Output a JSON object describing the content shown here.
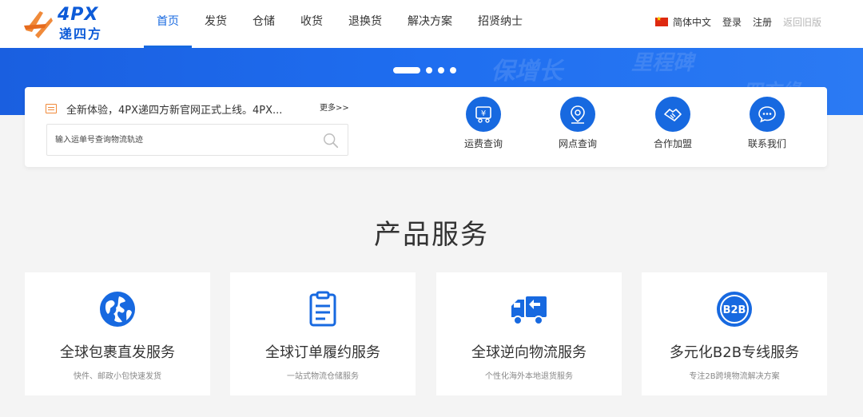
{
  "brand": {
    "logo_text": "4PX",
    "logo_sub": "递四方",
    "primary_color": "#1769e0",
    "accent_color": "#f08a3a"
  },
  "nav": {
    "items": [
      {
        "label": "首页",
        "active": true
      },
      {
        "label": "发货"
      },
      {
        "label": "仓储"
      },
      {
        "label": "收货"
      },
      {
        "label": "退换货"
      },
      {
        "label": "解决方案"
      },
      {
        "label": "招贤纳士"
      }
    ]
  },
  "top_right": {
    "language": "简体中文",
    "login": "登录",
    "register": "注册",
    "old_site": "返回旧版"
  },
  "banner": {
    "slide_count": 4,
    "active_slide": 1,
    "bg_texts": [
      "保增长",
      "里程碑",
      "四方缘"
    ]
  },
  "notice": {
    "text": "全新体验，4PX递四方新官网正式上线。4PX...",
    "more": "更多>>"
  },
  "search": {
    "placeholder": "输入运单号查询物流轨迹",
    "value": ""
  },
  "quick_links": [
    {
      "label": "运费查询",
      "icon": "freight-icon"
    },
    {
      "label": "网点查询",
      "icon": "location-icon"
    },
    {
      "label": "合作加盟",
      "icon": "handshake-icon"
    },
    {
      "label": "联系我们",
      "icon": "chat-icon"
    }
  ],
  "section": {
    "title": "产品服务"
  },
  "products": [
    {
      "title": "全球包裹直发服务",
      "desc": "快件、邮政小包快速发货",
      "icon": "globe-icon"
    },
    {
      "title": "全球订单履约服务",
      "desc": "一站式物流仓储服务",
      "icon": "clipboard-icon"
    },
    {
      "title": "全球逆向物流服务",
      "desc": "个性化海外本地退货服务",
      "icon": "return-truck-icon"
    },
    {
      "title": "多元化B2B专线服务",
      "desc": "专注2B跨境物流解决方案",
      "icon": "b2b-icon",
      "badge": "B2B"
    }
  ]
}
